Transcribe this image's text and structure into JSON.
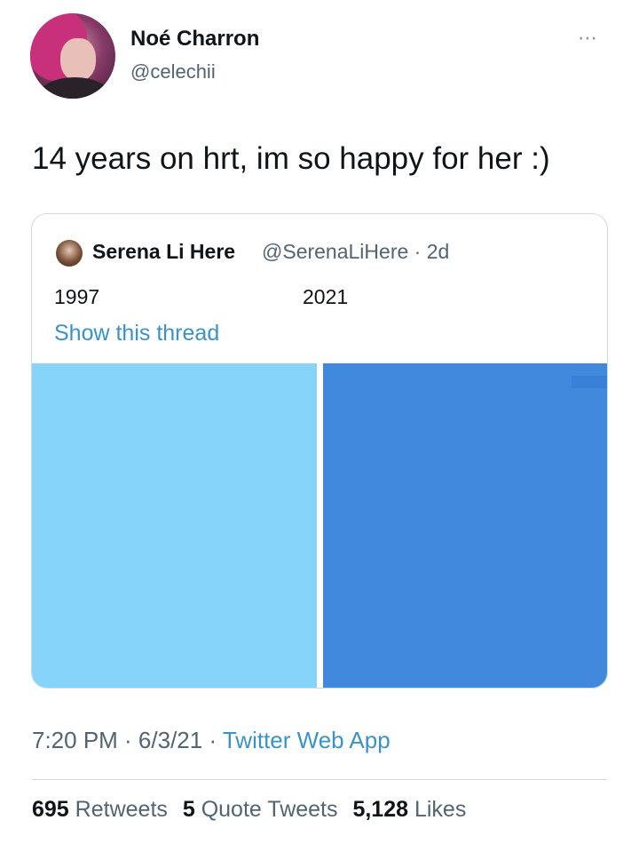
{
  "author": {
    "name": "Noé Charron",
    "handle": "@celechii"
  },
  "tweet_text": "14 years on hrt, im so happy for her :)",
  "more_icon": "⋯",
  "quoted": {
    "name": "Serena Li Here",
    "handle_time": "@SerenaLiHere · 2d",
    "label_left": "1997",
    "label_right": "2021",
    "show_thread": "Show this thread",
    "image_colors": [
      "#87d4fa",
      "#4189dc"
    ]
  },
  "meta": {
    "time_date": "7:20 PM · 6/3/21 · ",
    "app": "Twitter Web App"
  },
  "stats": {
    "retweets_count": "695",
    "retweets_label": "Retweets",
    "quotes_count": "5",
    "quotes_label": "Quote Tweets",
    "likes_count": "5,128",
    "likes_label": "Likes"
  }
}
